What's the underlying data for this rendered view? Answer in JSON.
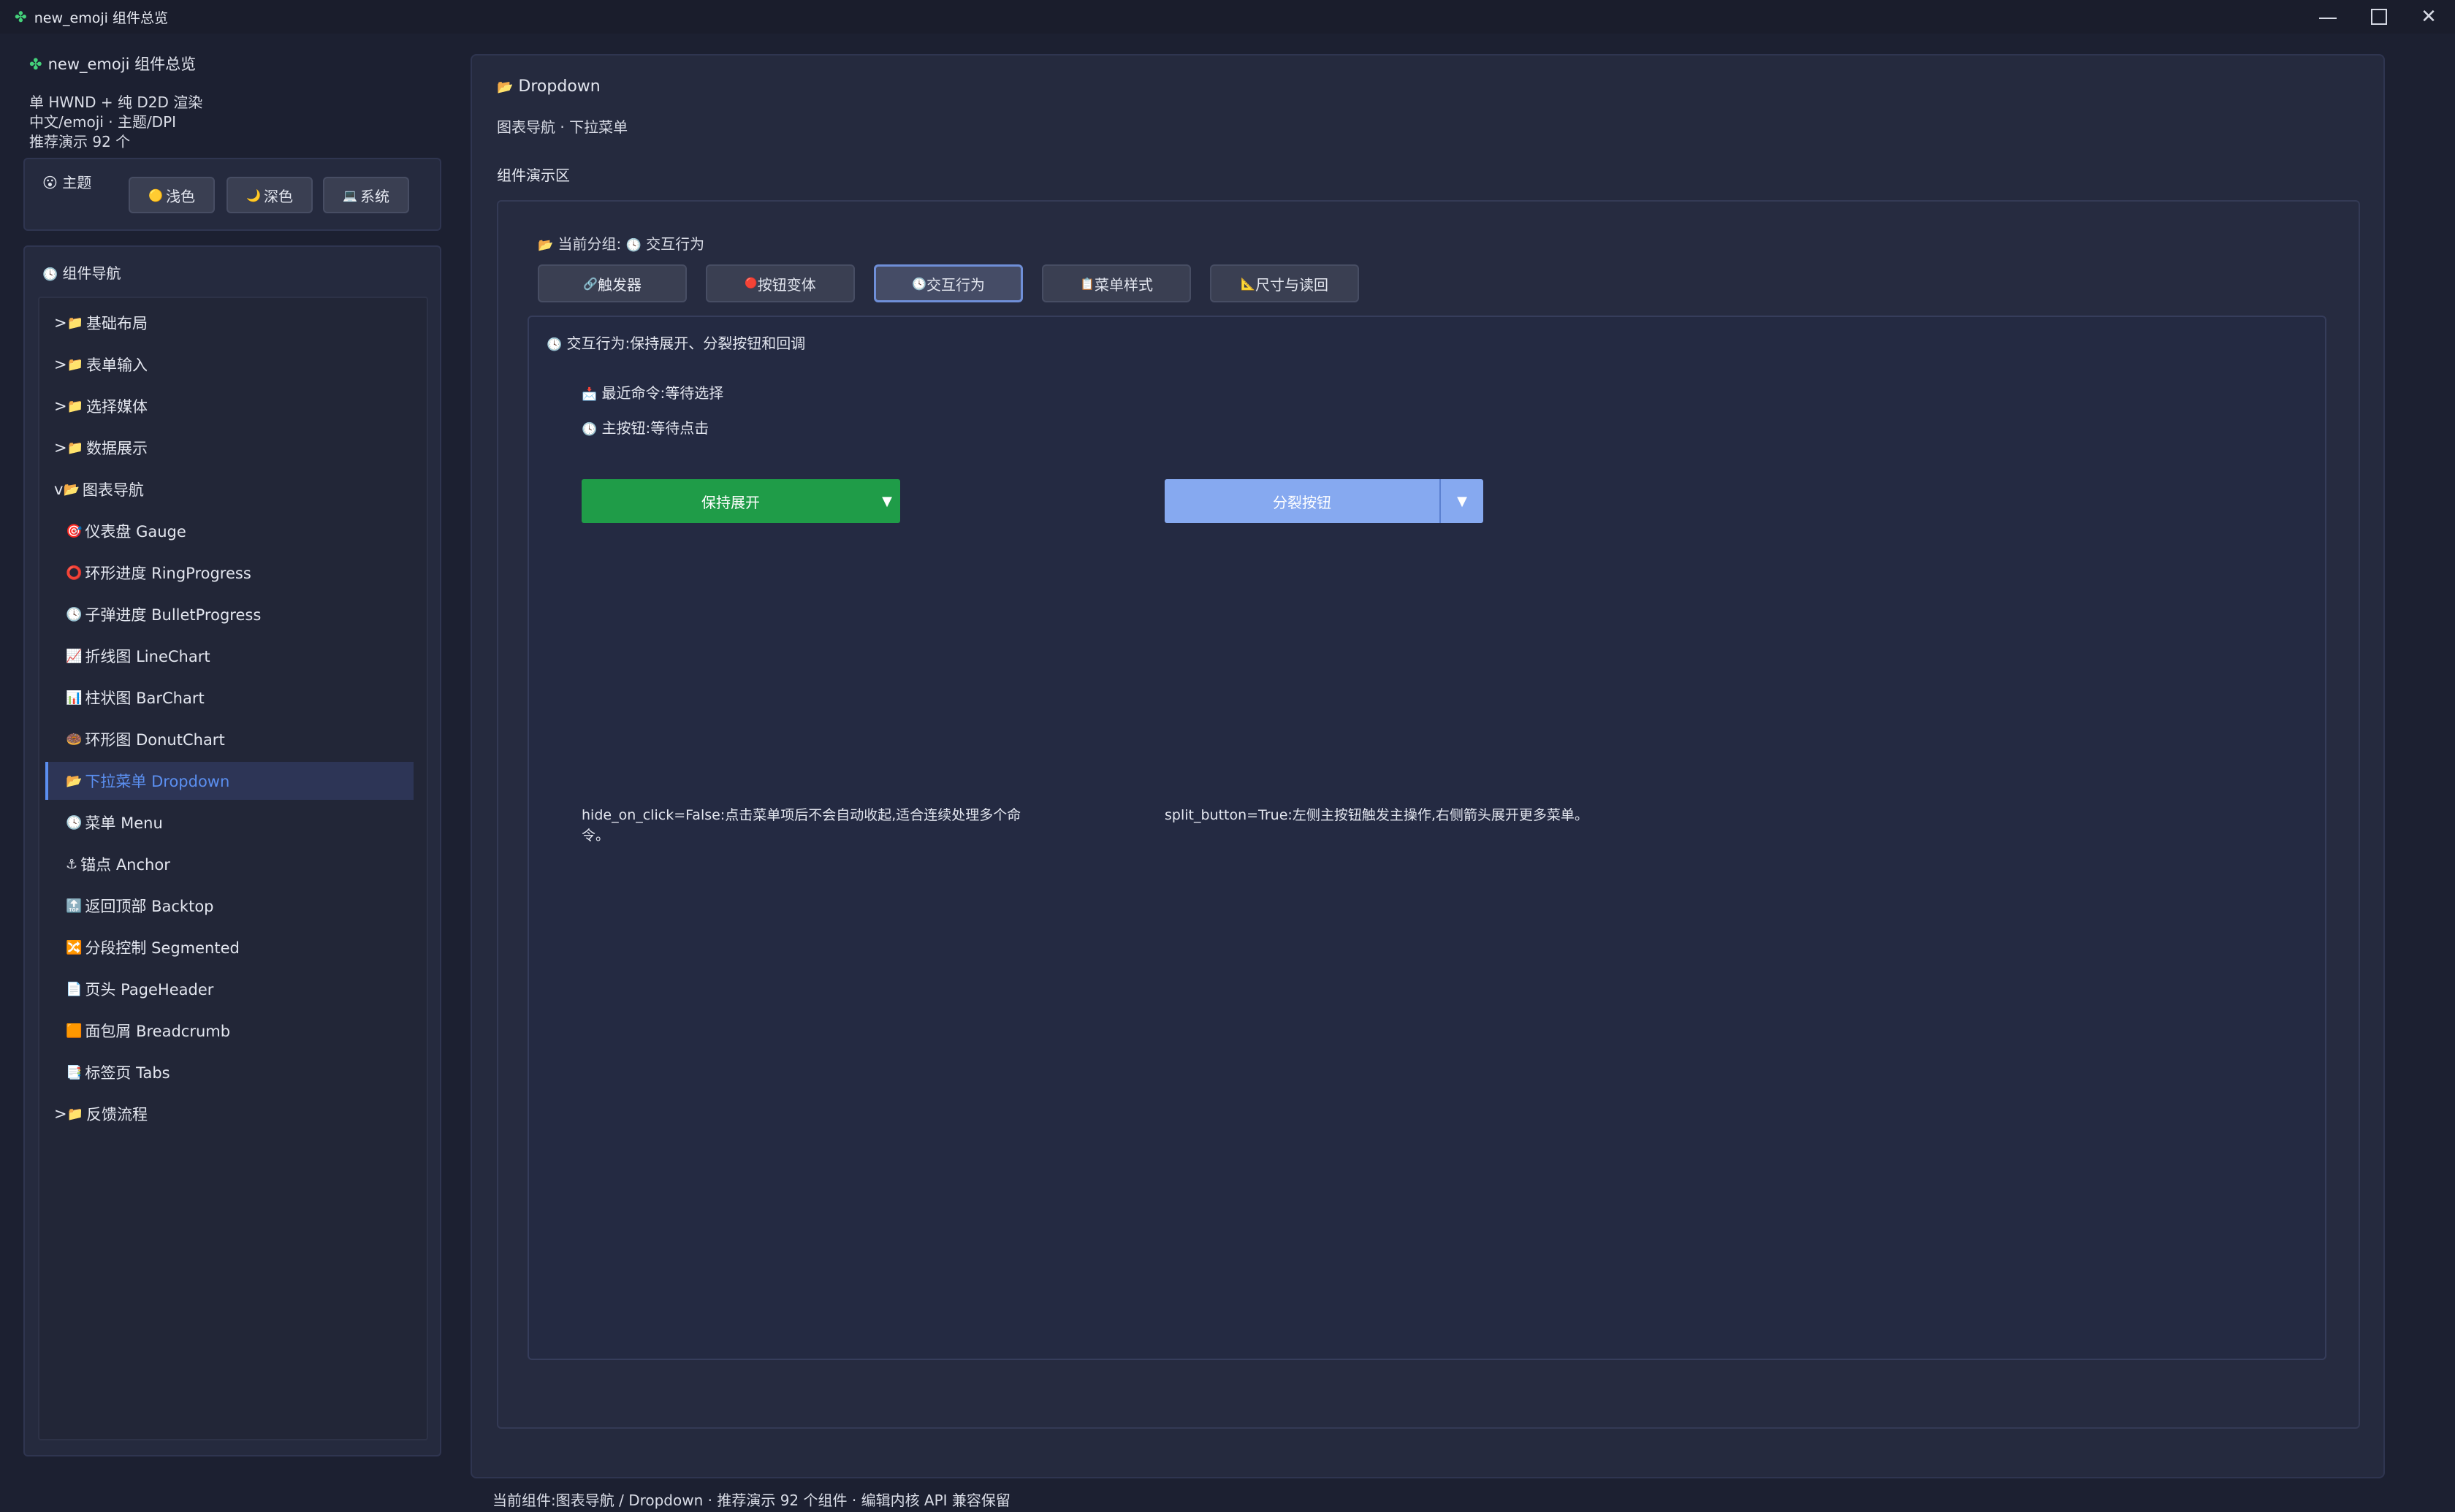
{
  "window": {
    "title": "new_emoji 组件总览",
    "app_icon": "✤",
    "controls": {
      "minimize": "minimize-icon",
      "maximize": "maximize-icon",
      "close": "close-icon"
    }
  },
  "sidebar": {
    "header": "new_emoji 组件总览",
    "header_icon": "✤",
    "lines": [
      "单 HWND + 纯 D2D 渲染",
      "中文/emoji · 主题/DPI",
      "推荐演示 92 个"
    ],
    "theme": {
      "icon": "😮",
      "label": "主题",
      "buttons": [
        {
          "icon": "🟡",
          "label": "浅色"
        },
        {
          "icon": "🌙",
          "label": "深色"
        },
        {
          "icon": "💻",
          "label": "系统"
        }
      ]
    },
    "nav": {
      "icon": "🕓",
      "title": "组件导航",
      "items": [
        {
          "prefix": ">",
          "icon": "📁",
          "label": "基础布局",
          "kind": "folder"
        },
        {
          "prefix": ">",
          "icon": "📁",
          "label": "表单输入",
          "kind": "folder"
        },
        {
          "prefix": ">",
          "icon": "📁",
          "label": "选择媒体",
          "kind": "folder"
        },
        {
          "prefix": ">",
          "icon": "📁",
          "label": "数据展示",
          "kind": "folder"
        },
        {
          "prefix": "v",
          "icon": "📂",
          "label": "图表导航",
          "kind": "folder"
        },
        {
          "prefix": "",
          "icon": "🎯",
          "label": "仪表盘 Gauge",
          "kind": "child"
        },
        {
          "prefix": "",
          "icon": "⭕",
          "label": "环形进度 RingProgress",
          "kind": "child"
        },
        {
          "prefix": "",
          "icon": "🕓",
          "label": "子弹进度 BulletProgress",
          "kind": "child"
        },
        {
          "prefix": "",
          "icon": "📈",
          "label": "折线图 LineChart",
          "kind": "child"
        },
        {
          "prefix": "",
          "icon": "📊",
          "label": "柱状图 BarChart",
          "kind": "child"
        },
        {
          "prefix": "",
          "icon": "🍩",
          "label": "环形图 DonutChart",
          "kind": "child"
        },
        {
          "prefix": "",
          "icon": "📂",
          "label": "下拉菜单 Dropdown",
          "kind": "child",
          "selected": true
        },
        {
          "prefix": "",
          "icon": "🕓",
          "label": "菜单 Menu",
          "kind": "child"
        },
        {
          "prefix": "",
          "icon": "⚓",
          "label": "锚点 Anchor",
          "kind": "child"
        },
        {
          "prefix": "",
          "icon": "🔝",
          "label": "返回顶部 Backtop",
          "kind": "child"
        },
        {
          "prefix": "",
          "icon": "🔀",
          "label": "分段控制 Segmented",
          "kind": "child"
        },
        {
          "prefix": "",
          "icon": "📄",
          "label": "页头 PageHeader",
          "kind": "child"
        },
        {
          "prefix": "",
          "icon": "🟧",
          "label": "面包屑 Breadcrumb",
          "kind": "child"
        },
        {
          "prefix": "",
          "icon": "📑",
          "label": "标签页 Tabs",
          "kind": "child"
        },
        {
          "prefix": ">",
          "icon": "📁",
          "label": "反馈流程",
          "kind": "folder"
        }
      ]
    }
  },
  "main": {
    "title_icon": "📂",
    "title": "Dropdown",
    "subtitle": "图表导航 · 下拉菜单",
    "section": "组件演示区",
    "group": {
      "icon": "📂",
      "label": "当前分组:",
      "value_icon": "🕓",
      "value": "交互行为"
    },
    "tabs": [
      {
        "icon": "🔗",
        "label": "触发器"
      },
      {
        "icon": "🔴",
        "label": "按钮变体"
      },
      {
        "icon": "🕓",
        "label": "交互行为",
        "active": true
      },
      {
        "icon": "📋",
        "label": "菜单样式"
      },
      {
        "icon": "📐",
        "label": "尺寸与读回"
      }
    ],
    "inner": {
      "title_icon": "🕓",
      "title": "交互行为:保持展开、分裂按钮和回调",
      "last_command": {
        "icon": "📩",
        "text": "最近命令:等待选择"
      },
      "main_button": {
        "icon": "🕓",
        "text": "主按钮:等待点击"
      },
      "keep_open_button": {
        "label": "保持展开",
        "arrow": "▼"
      },
      "split_button": {
        "label": "分裂按钮",
        "arrow": "▼"
      },
      "desc_left": [
        "hide_on_click=False:点击菜单项后不会自动收起,适合连续处理多个命",
        "令。"
      ],
      "desc_right": "split_button=True:左侧主按钮触发主操作,右侧箭头展开更多菜单。"
    }
  },
  "status": "当前组件:图表导航 / Dropdown · 推荐演示 92 个组件 · 编辑内核 API 兼容保留",
  "colors": {
    "accent": "#5b8ff0",
    "green": "#1f9c48",
    "split": "#86a9f0"
  }
}
